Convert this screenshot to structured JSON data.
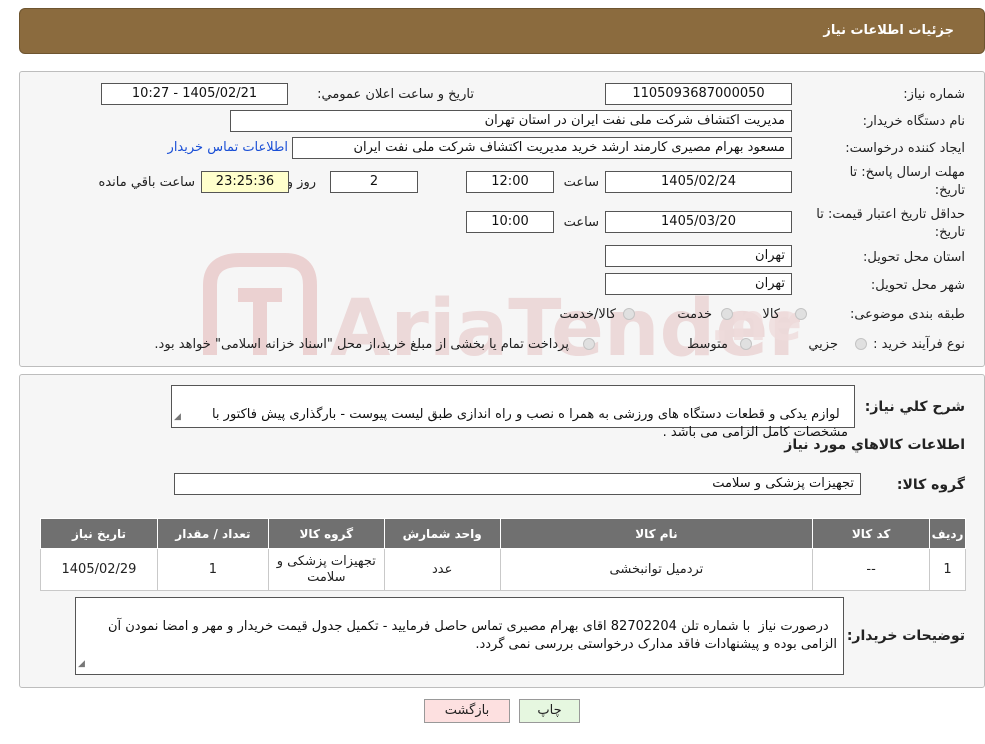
{
  "header": {
    "title": "جزئیات اطلاعات نیاز"
  },
  "form": {
    "need_number_label": "شماره نیاز:",
    "need_number": "1105093687000050",
    "announce_label": "تاریخ و ساعت اعلان عمومي:",
    "announce_value": "1405/02/21 - 10:27",
    "buyer_org_label": "نام دستگاه خريدار:",
    "buyer_org": "مدیریت اکتشاف شرکت ملی نفت ایران در استان تهران",
    "creator_label": "ايجاد کننده درخواست:",
    "creator": "مسعود بهرام مصیری کارمند ارشد خرید مدیریت اکتشاف شرکت ملی نفت ایران",
    "contact_link": "اطلاعات تماس خريدار",
    "deadline_label_1": "مهلت ارسال پاسخ: تا",
    "deadline_label_2": "تاريخ:",
    "deadline_date": "1405/02/24",
    "time_label": "ساعت",
    "deadline_time": "12:00",
    "days_value": "2",
    "days_label": "روز و",
    "remaining_time": "23:25:36",
    "remaining_label": "ساعت باقي مانده",
    "validity_label_1": "حداقل تاريخ اعتبار قيمت: تا",
    "validity_label_2": "تاريخ:",
    "validity_date": "1405/03/20",
    "validity_time_label": "ساعت",
    "validity_time": "10:00",
    "province_label": "استان محل تحويل:",
    "province": "تهران",
    "city_label": "شهر محل تحويل:",
    "city": "تهران",
    "category_label": "طبقه بندی موضوعی:",
    "category_options": [
      "کالا",
      "خدمت",
      "کالا/خدمت"
    ],
    "process_label": "نوع فرآيند خريد :",
    "process_options": [
      "جزيي",
      "متوسط"
    ],
    "process_note": "پرداخت تمام یا بخشی از مبلغ خرید،از محل \"اسناد خزانه اسلامی\" خواهد بود."
  },
  "summary": {
    "desc_label": "شرح کلي نياز:",
    "desc_text": "لوازم یدکی و قطعات دستگاه های ورزشی به همرا ه نصب و راه اندازی طبق لیست پیوست - بارگذاری پیش فاکتور با مشخصات کامل الزامی می باشد .",
    "goods_info_title": "اطلاعات کالاهاي مورد نياز",
    "goods_group_label": "گروه کالا:",
    "goods_group": "تجهیزات پزشکی و سلامت"
  },
  "table": {
    "headers": [
      "رديف",
      "کد کالا",
      "نام کالا",
      "واحد شمارش",
      "گروه کالا",
      "تعداد / مقدار",
      "تاریخ نیاز"
    ],
    "rows": [
      [
        "1",
        "--",
        "تردمیل توانبخشی",
        "عدد",
        "تجهیزات پزشکی و سلامت",
        "1",
        "1405/02/29"
      ]
    ]
  },
  "buyer_notes": {
    "label": "توضيحات خريدار:",
    "text": "درصورت نیاز  با شماره تلن 82702204 اقای بهرام مصیری تماس حاصل فرمایید - تکمیل جدول قیمت خریدار و مهر و امضا نمودن آن الزامی بوده و پیشنهادات فاقد مدارک درخواستی بررسی نمی گردد."
  },
  "buttons": {
    "print": "چاپ",
    "back": "بازگشت"
  },
  "colors": {
    "header": "#8b6b3e",
    "table_header": "#707070",
    "link": "#1a4fd6",
    "back_button": "#fde0e0",
    "print_button": "#e6f7e0"
  }
}
